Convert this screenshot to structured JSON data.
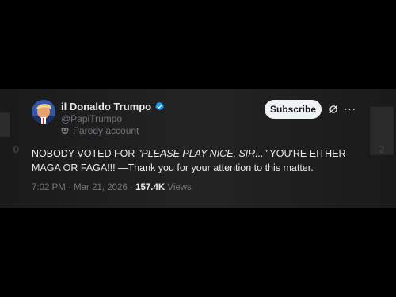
{
  "author": {
    "name": "il Donaldo Trumpo",
    "handle": "@PapiTrumpo",
    "badge_label": "Parody account",
    "verified_color": "#1d9bf0"
  },
  "actions": {
    "subscribe_label": "Subscribe"
  },
  "post": {
    "text_part1": "NOBODY VOTED FOR ",
    "text_italic": "\"PLEASE PLAY NICE, SIR...\"",
    "text_part2": " YOU'RE EITHER MAGA OR FAGA!!! —Thank you for your attention to this matter."
  },
  "meta": {
    "time": "7:02 PM",
    "date": "Mar 21, 2026",
    "views_count": "157.4K",
    "views_label": "Views",
    "separator": "·"
  },
  "colors": {
    "background": "#000000",
    "text_primary": "#e7e9ea",
    "text_secondary": "#71767b",
    "button_bg": "#eff3f4"
  }
}
